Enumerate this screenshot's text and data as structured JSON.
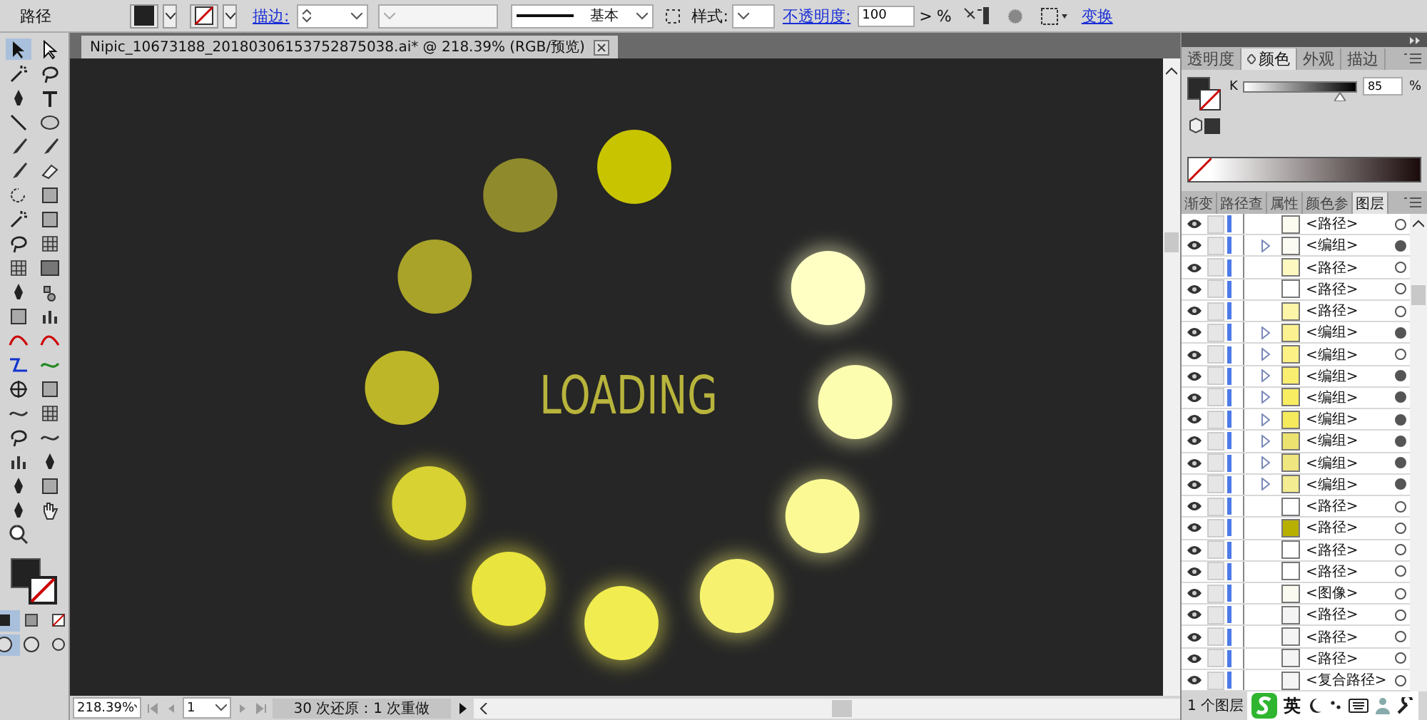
{
  "control_bar": {
    "selection_label": "路径",
    "stroke_label": "描边:",
    "stroke_profile": "基本",
    "style_label": "样式:",
    "opacity_label": "不透明度:",
    "opacity_value": "100",
    "opacity_arrow": ">",
    "opacity_unit": "%",
    "transform_link": "变换"
  },
  "document_tab": {
    "title": "Nipic_10673188_20180306153752875038.ai* @ 218.39% (RGB/预览)"
  },
  "artboard": {
    "text": "LOADING"
  },
  "color_panel": {
    "tabs": [
      {
        "label": "透明度",
        "selected": false
      },
      {
        "label": "颜色",
        "selected": true
      },
      {
        "label": "外观",
        "selected": false
      },
      {
        "label": "描边",
        "selected": false
      }
    ],
    "channel_label": "K",
    "level": 0.85,
    "value": "85",
    "unit": "%"
  },
  "layers_panel": {
    "tabs": [
      {
        "label": "渐变",
        "selected": false
      },
      {
        "label": "路径查",
        "selected": false
      },
      {
        "label": "属性",
        "selected": false
      },
      {
        "label": "颜色参",
        "selected": false
      },
      {
        "label": "图层",
        "selected": true
      }
    ],
    "rows": [
      {
        "label": "<路径>",
        "color": "#fbfbf0",
        "expandable": false,
        "targeted": false
      },
      {
        "label": "<编组>",
        "color": "#fbfbf4",
        "expandable": true,
        "targeted": true
      },
      {
        "label": "<路径>",
        "color": "#fdf8c0",
        "expandable": false,
        "targeted": false
      },
      {
        "label": "<路径>",
        "color": "#ffffff",
        "expandable": false,
        "targeted": false
      },
      {
        "label": "<路径>",
        "color": "#fdf5a8",
        "expandable": false,
        "targeted": false
      },
      {
        "label": "<编组>",
        "color": "#fbf190",
        "expandable": true,
        "targeted": true
      },
      {
        "label": "<编组>",
        "color": "#fbf184",
        "expandable": true,
        "targeted": false
      },
      {
        "label": "<编组>",
        "color": "#f9ee70",
        "expandable": true,
        "targeted": true
      },
      {
        "label": "<编组>",
        "color": "#f8ec62",
        "expandable": true,
        "targeted": true
      },
      {
        "label": "<编组>",
        "color": "#f5ea5c",
        "expandable": true,
        "targeted": true
      },
      {
        "label": "<编组>",
        "color": "#ece270",
        "expandable": true,
        "targeted": true
      },
      {
        "label": "<编组>",
        "color": "#efe680",
        "expandable": true,
        "targeted": true
      },
      {
        "label": "<编组>",
        "color": "#f3ec90",
        "expandable": true,
        "targeted": true
      },
      {
        "label": "<路径>",
        "color": "#ffffff",
        "expandable": false,
        "targeted": false
      },
      {
        "label": "<路径>",
        "color": "#b8b000",
        "expandable": false,
        "targeted": false
      },
      {
        "label": "<路径>",
        "color": "#ffffff",
        "expandable": false,
        "targeted": false
      },
      {
        "label": "<路径>",
        "color": "#ffffff",
        "expandable": false,
        "targeted": false
      },
      {
        "label": "<图像>",
        "color": "#fafaf0",
        "expandable": false,
        "targeted": false
      },
      {
        "label": "<路径>",
        "color": "#f4f4f4",
        "expandable": false,
        "targeted": false
      },
      {
        "label": "<路径>",
        "color": "#f4f4f4",
        "expandable": false,
        "targeted": false
      },
      {
        "label": "<路径>",
        "color": "#f4f4f4",
        "expandable": false,
        "targeted": false
      },
      {
        "label": "<复合路径>",
        "color": "#f4f4f4",
        "expandable": false,
        "targeted": false
      }
    ],
    "layer_count": "1 个图层"
  },
  "status_bar": {
    "zoom": "218.39%",
    "artboard": "1",
    "history": "30 次还原：1 次重做"
  },
  "ime_bar": {
    "mode": "英"
  }
}
